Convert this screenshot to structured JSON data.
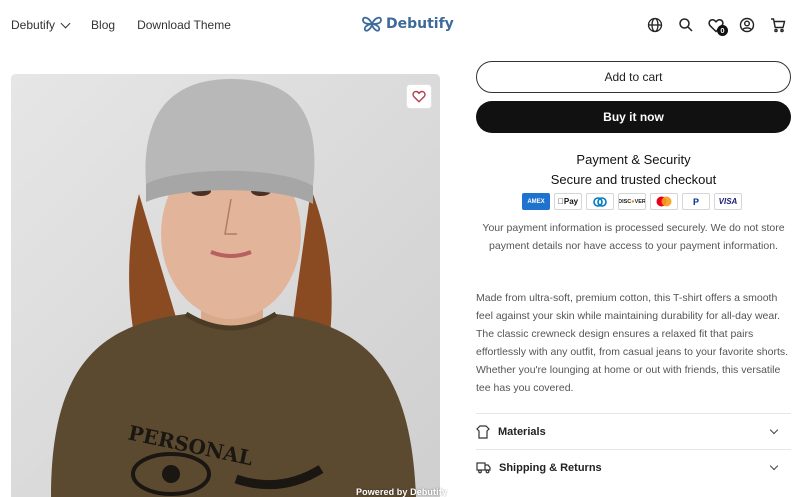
{
  "header": {
    "nav": [
      {
        "label": "Debutify",
        "has_dropdown": true
      },
      {
        "label": "Blog"
      },
      {
        "label": "Download Theme"
      }
    ],
    "logo_text": "Debutify",
    "cart_badge_count": "0",
    "icons": [
      "globe-icon",
      "search-icon",
      "wishlist-icon",
      "account-icon",
      "cart-icon"
    ]
  },
  "product": {
    "image_alt": "Model wearing grey beanie and brown graphic T-shirt",
    "shirt_print_text": "PERSONAL",
    "powered_by": "Powered by",
    "powered_brand": "Debutify"
  },
  "buttons": {
    "add_to_cart": "Add to cart",
    "buy_now": "Buy it now"
  },
  "payment": {
    "title": "Payment & Security",
    "subtitle": "Secure and trusted checkout",
    "methods": [
      "American Express",
      "Apple Pay",
      "Diners Club",
      "Discover",
      "Mastercard",
      "PayPal",
      "Visa"
    ],
    "note": "Your payment information is processed securely. We do not store payment details nor have access to your payment information."
  },
  "description": "Made from ultra-soft, premium cotton, this T-shirt offers a smooth feel against your skin while maintaining durability for all-day wear. The classic crewneck design ensures a relaxed fit that pairs effortlessly with any outfit, from casual jeans to your favorite shorts. Whether you're lounging at home or out with friends, this versatile tee has you covered.",
  "accordions": [
    {
      "label": "Materials",
      "icon": "fabric-icon"
    },
    {
      "label": "Shipping & Returns",
      "icon": "truck-icon"
    }
  ],
  "colors": {
    "brand_logo": "#3e6a9a",
    "primary_button": "#111111",
    "wishlist_heart": "#b04050"
  }
}
